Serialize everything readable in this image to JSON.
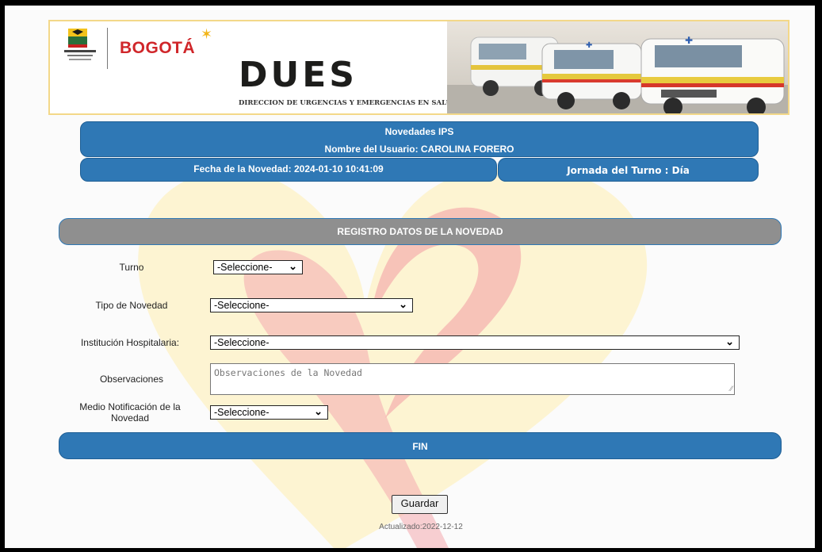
{
  "banner": {
    "logo_caption": "ALCALDÍA MAYOR DE BOGOTÁ D.C.",
    "city": "BOGOTÁ",
    "title": "DUES",
    "subtitle": "DIRECCION DE URGENCIAS Y EMERGENCIAS EN SALUD"
  },
  "header": {
    "title": "Novedades IPS",
    "user": "Nombre del Usuario: CAROLINA FORERO",
    "fecha": "Fecha de la Novedad: 2024-01-10 10:41:09",
    "jornada": "Jornada del Turno : Día"
  },
  "section": {
    "title": "REGISTRO DATOS DE LA NOVEDAD"
  },
  "form": {
    "turno": {
      "label": "Turno",
      "value": "-Seleccione-"
    },
    "tipo": {
      "label": "Tipo de Novedad",
      "value": "-Seleccione-"
    },
    "institucion": {
      "label": "Institución Hospitalaria:",
      "value": "-Seleccione-"
    },
    "observaciones": {
      "label": "Observaciones",
      "placeholder": "Observaciones de la Novedad"
    },
    "medio": {
      "label_line1": "Medio Notificación de la",
      "label_line2": "Novedad",
      "value": "-Seleccione-"
    }
  },
  "footer": {
    "fin": "FIN",
    "save_label": "Guardar",
    "updated": "Actualizado:2022-12-12"
  },
  "colors": {
    "bar_blue": "#2f78b5",
    "section_gray": "#8f8f8f",
    "heart_pink": "#f2a0a8",
    "heart_yellow": "#ffe28a"
  }
}
